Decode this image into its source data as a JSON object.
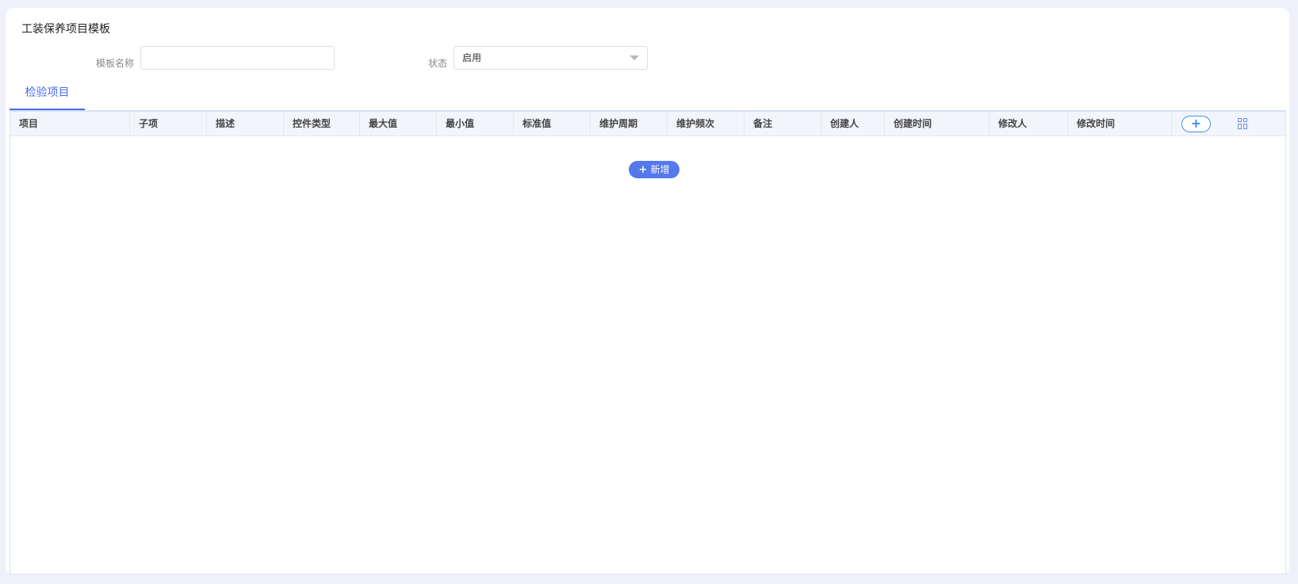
{
  "page": {
    "title": "工装保养项目模板"
  },
  "form": {
    "template_name": {
      "label": "模板名称",
      "value": ""
    },
    "status": {
      "label": "状态",
      "value": "启用"
    }
  },
  "tabs": [
    {
      "label": "检验项目",
      "active": true
    }
  ],
  "table": {
    "columns": [
      "项目",
      "子项",
      "描述",
      "控件类型",
      "最大值",
      "最小值",
      "标准值",
      "维护周期",
      "维护频次",
      "备注",
      "创建人",
      "创建时间",
      "修改人",
      "修改时间"
    ],
    "rows": [],
    "add_column_icon": "plus-icon",
    "column_settings_icon": "grid-settings-icon"
  },
  "add_button": {
    "icon": "plus-icon",
    "label": "新增"
  },
  "colors": {
    "accent": "#4a6cf0",
    "button": "#5478ee",
    "header_bg": "#f3f5fd",
    "page_bg": "#eef1fb"
  }
}
